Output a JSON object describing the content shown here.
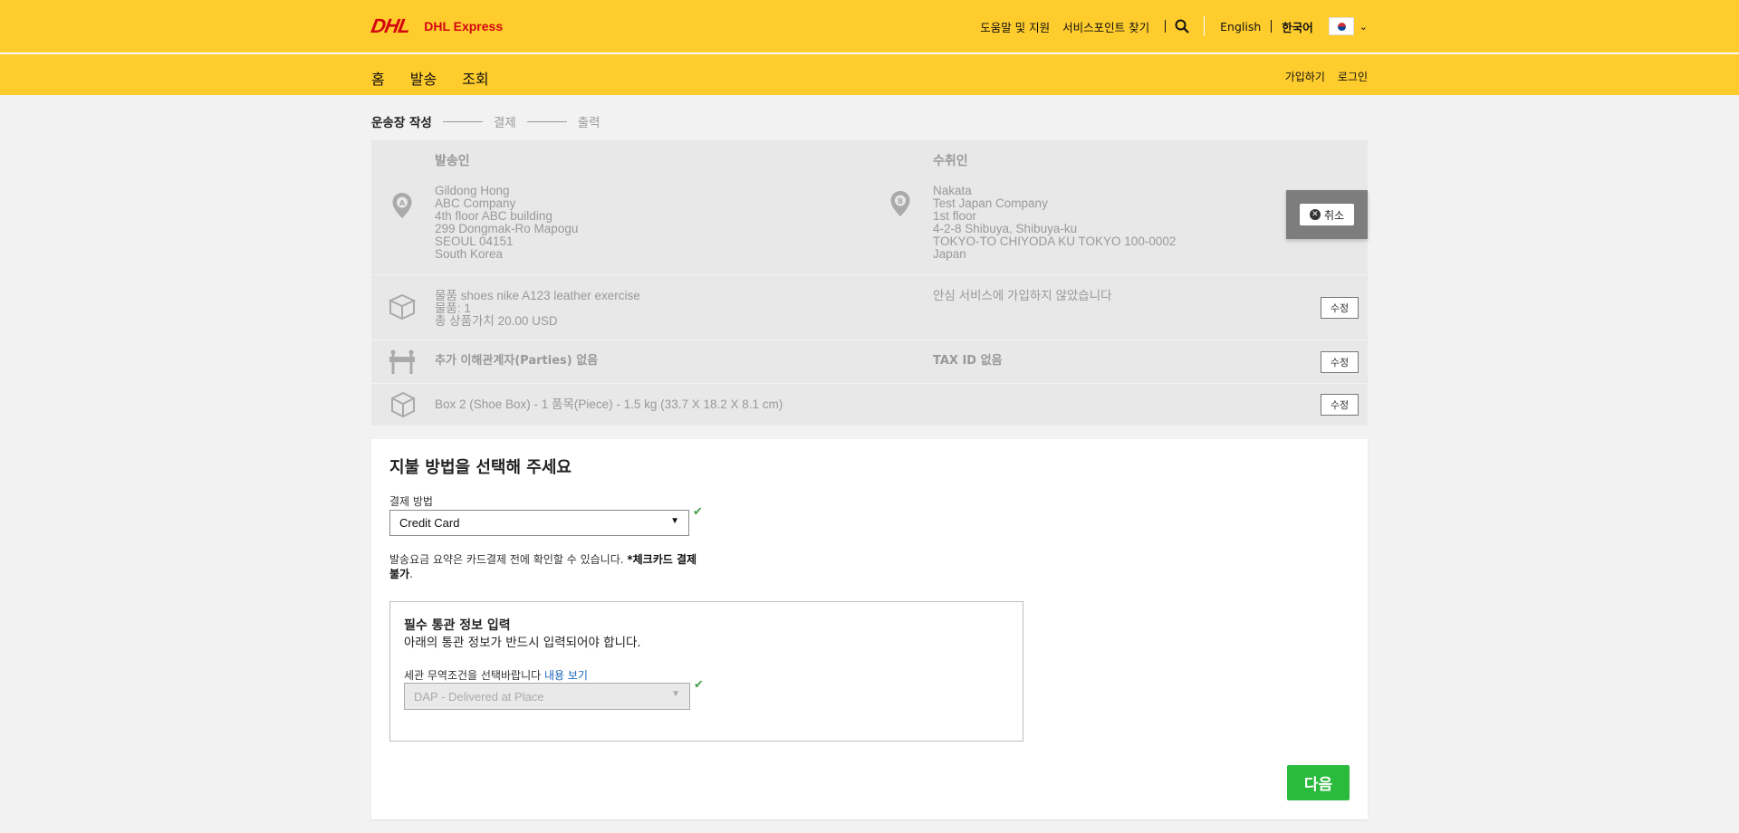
{
  "header": {
    "logo_text": "DHL",
    "logo_sub": "DHL Express",
    "links": [
      "도움말 및 지원",
      "서비스포인트 찾기"
    ],
    "lang_en": "English",
    "lang_ko": "한국어"
  },
  "nav": {
    "items": [
      "홈",
      "발송",
      "조회"
    ],
    "signup": "가입하기",
    "login": "로그인"
  },
  "steps": [
    "운송장 작성",
    "결제",
    "출력"
  ],
  "shipper": {
    "title": "발송인",
    "badge": "A",
    "lines": [
      "Gildong Hong",
      "ABC Company",
      "4th floor ABC building",
      "299 Dongmak-Ro Mapogu",
      "SEOUL 04151",
      "South Korea"
    ]
  },
  "receiver": {
    "title": "수취인",
    "badge": "B",
    "lines": [
      "Nakata",
      "Test Japan Company",
      "1st floor",
      "4-2-8 Shibuya, Shibuya-ku",
      "TOKYO-TO CHIYODA KU TOKYO 100-0002",
      "Japan"
    ]
  },
  "cancel_label": "취소",
  "item": {
    "lines": [
      "물품 shoes nike A123 leather exercise",
      "물품: 1",
      "총 상품가치 20.00 USD"
    ],
    "insurance": "안심 서비스에 가입하지 않았습니다",
    "edit": "수정"
  },
  "parties": {
    "text": "추가 이해관계자(Parties) 없음",
    "tax": "TAX ID 없음",
    "edit": "수정"
  },
  "package": {
    "text": "Box 2 (Shoe Box) - 1 품목(Piece) - 1.5 kg (33.7 X 18.2 X 8.1 cm)",
    "edit": "수정"
  },
  "payment": {
    "title": "지불 방법을 선택해 주세요",
    "method_label": "결제 방법",
    "method_value": "Credit Card",
    "note_text": "발송요금 요약은 카드결제 전에 확인할 수 있습니다. ",
    "note_bold": "*체크카드 결제 불가",
    "note_end": ".",
    "customs_title": "필수 통관 정보 입력",
    "customs_desc": "아래의 통관 정보가 반드시 입력되어야 합니다.",
    "incoterm_label": "세관 무역조건을 선택바랍니다 ",
    "incoterm_link": "내용 보기",
    "incoterm_value": "DAP - Delivered at Place",
    "next": "다음"
  }
}
